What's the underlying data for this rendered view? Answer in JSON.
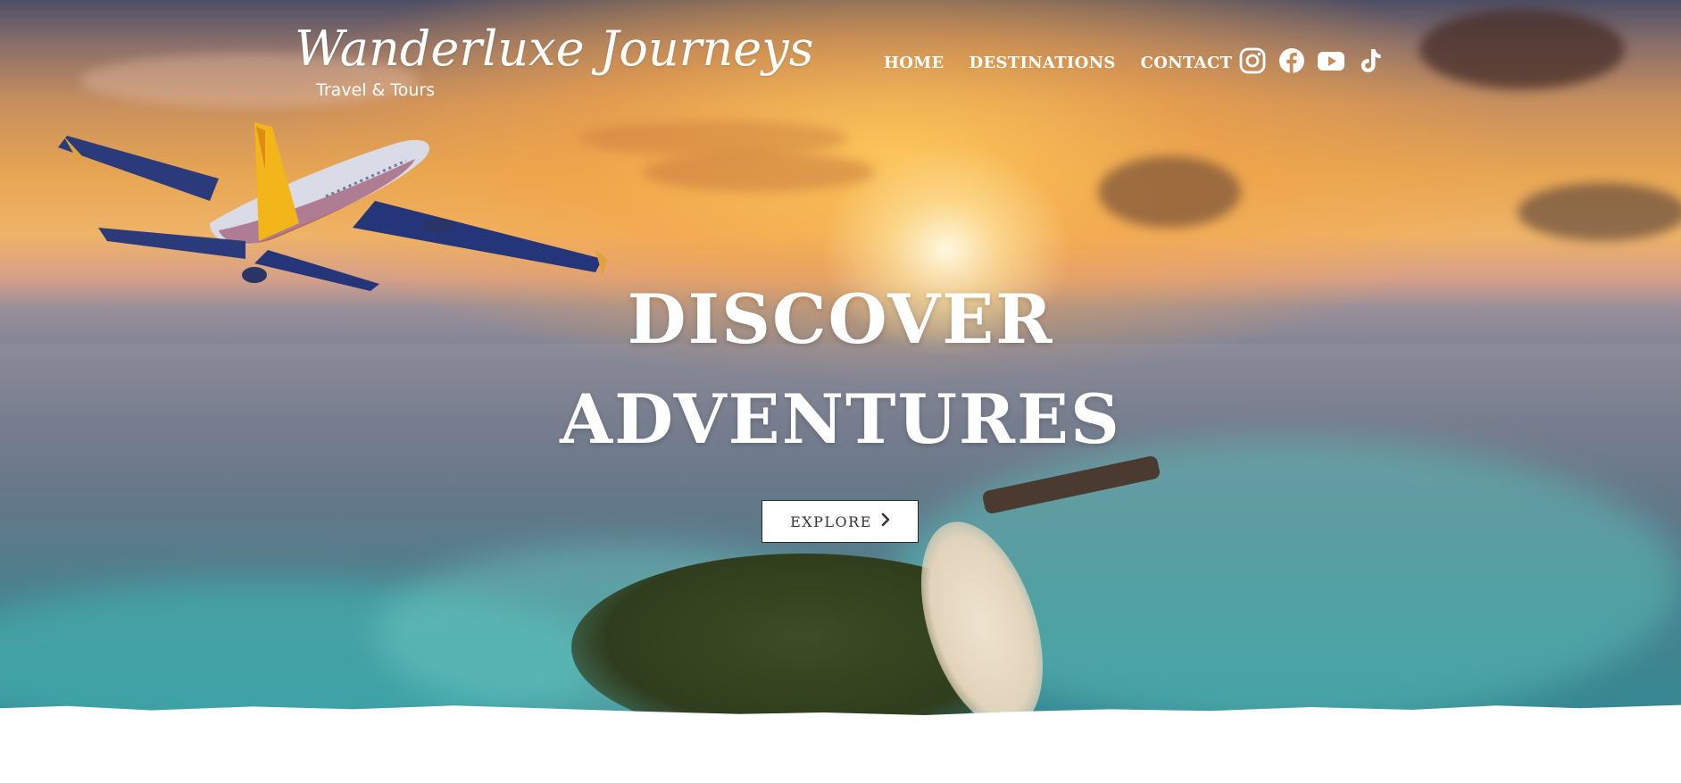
{
  "brand": {
    "name": "Wanderluxe Journeys",
    "tagline": "Travel & Tours"
  },
  "nav": {
    "items": [
      {
        "label": "HOME"
      },
      {
        "label": "DESTINATIONS"
      },
      {
        "label": "CONTACT"
      }
    ]
  },
  "social": {
    "icons": [
      "instagram-icon",
      "facebook-icon",
      "youtube-icon",
      "tiktok-icon"
    ]
  },
  "hero": {
    "headline_line1": "DISCOVER",
    "headline_line2": "ADVENTURES",
    "cta_label": "EXPLORE"
  },
  "colors": {
    "text_light": "#ffffff",
    "button_bg": "#ffffff",
    "button_text": "#333333",
    "sunset_gold": "#efb367",
    "lagoon_teal": "#2f9c9f"
  }
}
